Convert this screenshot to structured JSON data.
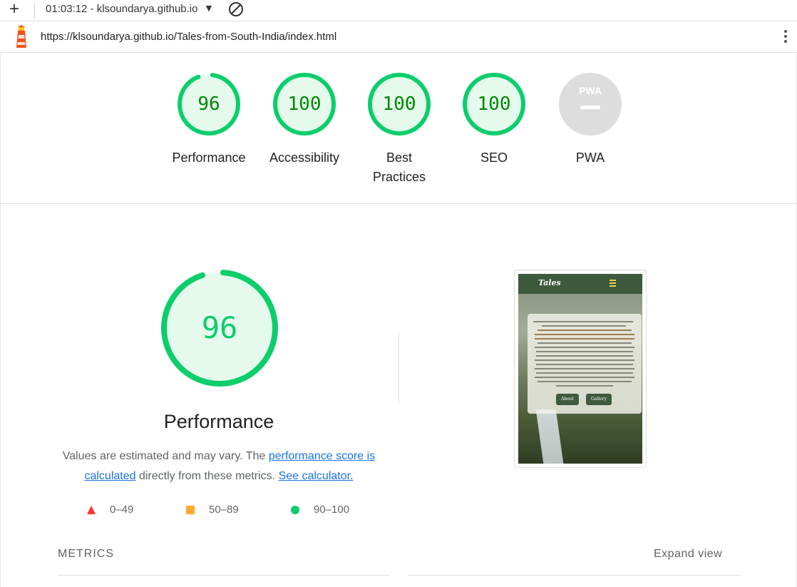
{
  "toolbar": {
    "time_title": "01:03:12 - klsoundarya.github.io",
    "add_icon": "plus-icon",
    "dropdown_icon": "caret-down-icon",
    "clear_icon": "block-icon"
  },
  "urlbar": {
    "url": "https://klsoundarya.github.io/Tales-from-South-India/index.html",
    "logo_icon": "lighthouse-icon",
    "menu_icon": "kebab-menu-icon"
  },
  "gauges": [
    {
      "label": "Performance",
      "score": "96",
      "value": 96
    },
    {
      "label": "Accessibility",
      "score": "100",
      "value": 100
    },
    {
      "label": "Best\nPractices",
      "label_line1": "Best",
      "label_line2": "Practices",
      "score": "100",
      "value": 100
    },
    {
      "label": "SEO",
      "score": "100",
      "value": 100
    },
    {
      "label": "PWA",
      "score": "PWA",
      "value": null
    }
  ],
  "performance": {
    "score": "96",
    "value": 96,
    "title": "Performance",
    "desc_prefix": "Values are estimated and may vary. The ",
    "link_score": "performance score is calculated",
    "desc_middle": " directly from these metrics. ",
    "link_calc": "See calculator."
  },
  "legend": [
    {
      "range": "0–49",
      "shape": "triangle",
      "color": "#ff3333"
    },
    {
      "range": "50–89",
      "shape": "square",
      "color": "#ffaa33"
    },
    {
      "range": "90–100",
      "shape": "circle",
      "color": "#0cce6b"
    }
  ],
  "screenshot": {
    "logo": "Tales",
    "btn_about": "About",
    "btn_gallery": "Gallery"
  },
  "metrics": {
    "heading": "METRICS",
    "expand_label": "Expand view"
  },
  "colors": {
    "pass": "#0cce6b",
    "pass_bg": "#e5f9ed",
    "pass_text": "#008800",
    "na": "#dddddd"
  }
}
